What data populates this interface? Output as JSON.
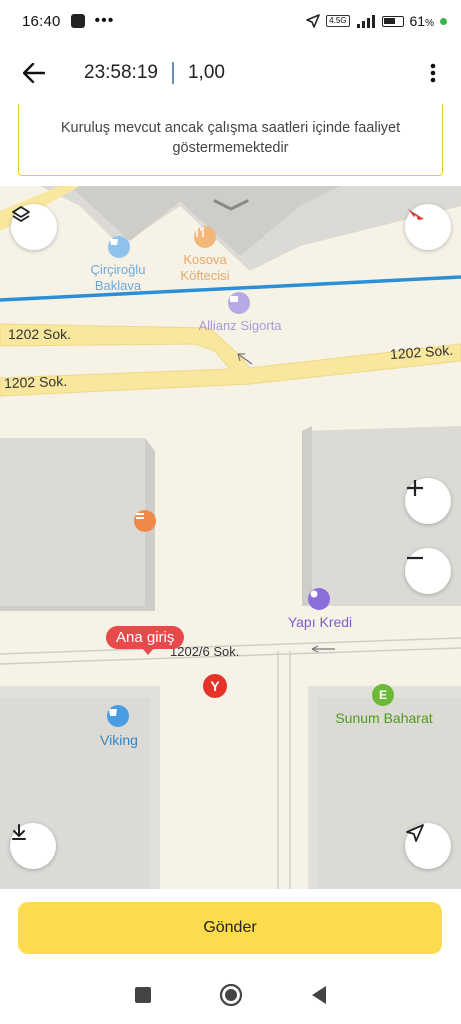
{
  "status_bar": {
    "time": "16:40",
    "network": "4.5G",
    "battery": "61",
    "battery_unit": "%"
  },
  "header": {
    "time": "23:58:19",
    "value": "1,00"
  },
  "notice": {
    "text": "Kuruluş mevcut ancak çalışma saatleri içinde faaliyet göstermemektedir"
  },
  "map": {
    "streets": {
      "s1": "1202 Sok.",
      "s2": "1202 Sok.",
      "s3": "1202 Sok.",
      "s4": "1202/6 Sok."
    },
    "pois": {
      "circiroglu": "Çirçiroğlu Baklava",
      "kosova": "Kosova Köftecisi",
      "allianz": "Allianz Sigorta",
      "yapikredi": "Yapı Kredi",
      "viking": "Viking",
      "sunum": "Sunum Baharat"
    },
    "entrance_label": "Ana giriş",
    "colors": {
      "road": "#f8e79c",
      "building": "#d9d9d9",
      "transit_line": "#2a8fd6",
      "entrance": "#e8494b"
    }
  },
  "send_button": "Gönder"
}
